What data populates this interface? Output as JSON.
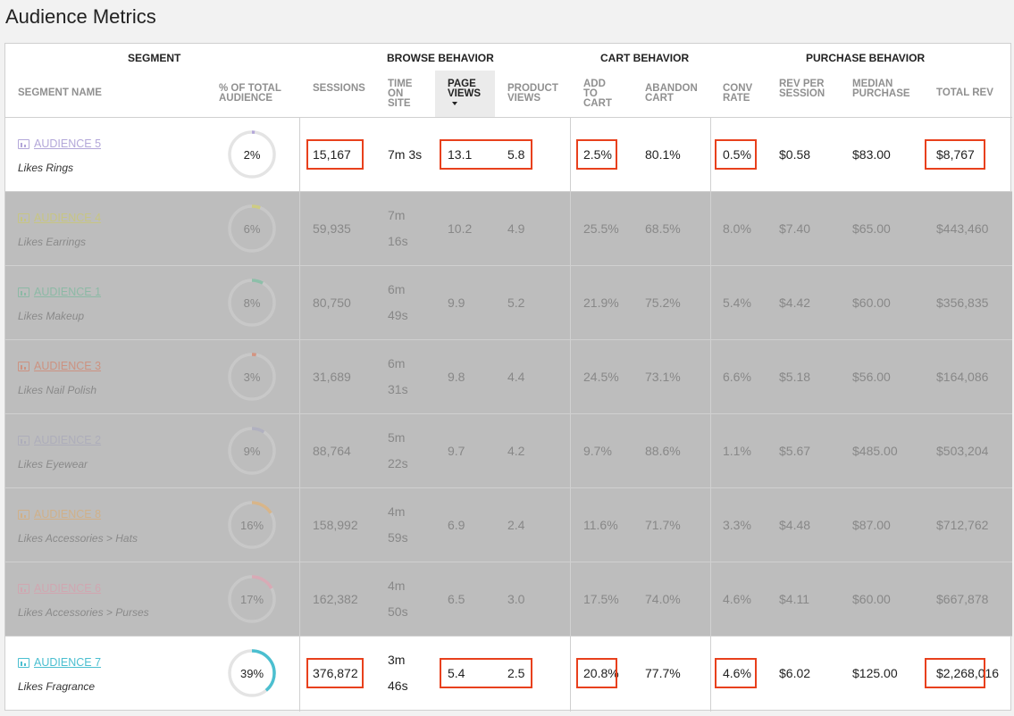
{
  "page_title": "Audience Metrics",
  "groups": {
    "segment": "SEGMENT",
    "browse": "BROWSE BEHAVIOR",
    "cart": "CART BEHAVIOR",
    "purchase": "PURCHASE BEHAVIOR"
  },
  "columns": {
    "segment_name": "SEGMENT NAME",
    "pct_total": "% OF TOTAL\nAUDIENCE",
    "sessions": "SESSIONS",
    "time_on_site": "TIME\nON\nSITE",
    "page_views": "PAGE\nVIEWS",
    "product_views": "PRODUCT\nVIEWS",
    "add_to_cart": "ADD\nTO\nCART",
    "abandon_cart": "ABANDON\nCART",
    "conv_rate": "CONV\nRATE",
    "rev_per_session": "REV PER\nSESSION",
    "median_purchase": "MEDIAN\nPURCHASE",
    "total_rev": "TOTAL REV"
  },
  "rows": [
    {
      "name": "AUDIENCE 5",
      "desc": "Likes Rings",
      "color": "#b3a7d9",
      "pct_label": "2%",
      "pct": 0.02,
      "sessions": "15,167",
      "time": "7m 3s",
      "page_views": "13.1",
      "product_views": "5.8",
      "add_to_cart": "2.5%",
      "abandon_cart": "80.1%",
      "conv_rate": "0.5%",
      "rev_per_session": "$0.58",
      "median_purchase": "$83.00",
      "total_rev": "$8,767",
      "dimmed": false
    },
    {
      "name": "AUDIENCE 4",
      "desc": "Likes Earrings",
      "color": "#d4cf3e",
      "pct_label": "6%",
      "pct": 0.06,
      "sessions": "59,935",
      "time": "7m\n16s",
      "page_views": "10.2",
      "product_views": "4.9",
      "add_to_cart": "25.5%",
      "abandon_cart": "68.5%",
      "conv_rate": "8.0%",
      "rev_per_session": "$7.40",
      "median_purchase": "$65.00",
      "total_rev": "$443,460",
      "dimmed": true
    },
    {
      "name": "AUDIENCE 1",
      "desc": "Likes Makeup",
      "color": "#52b68a",
      "pct_label": "8%",
      "pct": 0.08,
      "sessions": "80,750",
      "time": "6m\n49s",
      "page_views": "9.9",
      "product_views": "5.2",
      "add_to_cart": "21.9%",
      "abandon_cart": "75.2%",
      "conv_rate": "5.4%",
      "rev_per_session": "$4.42",
      "median_purchase": "$60.00",
      "total_rev": "$356,835",
      "dimmed": true
    },
    {
      "name": "AUDIENCE 3",
      "desc": "Likes Nail Polish",
      "color": "#e0603a",
      "pct_label": "3%",
      "pct": 0.03,
      "sessions": "31,689",
      "time": "6m\n31s",
      "page_views": "9.8",
      "product_views": "4.4",
      "add_to_cart": "24.5%",
      "abandon_cart": "73.1%",
      "conv_rate": "6.6%",
      "rev_per_session": "$5.18",
      "median_purchase": "$56.00",
      "total_rev": "$164,086",
      "dimmed": true
    },
    {
      "name": "AUDIENCE 2",
      "desc": "Likes Eyewear",
      "color": "#9a9ab8",
      "pct_label": "9%",
      "pct": 0.09,
      "sessions": "88,764",
      "time": "5m\n22s",
      "page_views": "9.7",
      "product_views": "4.2",
      "add_to_cart": "9.7%",
      "abandon_cart": "88.6%",
      "conv_rate": "1.1%",
      "rev_per_session": "$5.67",
      "median_purchase": "$485.00",
      "total_rev": "$503,204",
      "dimmed": true
    },
    {
      "name": "AUDIENCE 8",
      "desc": "Likes Accessories > Hats",
      "color": "#e8a24a",
      "pct_label": "16%",
      "pct": 0.16,
      "sessions": "158,992",
      "time": "4m\n59s",
      "page_views": "6.9",
      "product_views": "2.4",
      "add_to_cart": "11.6%",
      "abandon_cart": "71.7%",
      "conv_rate": "3.3%",
      "rev_per_session": "$4.48",
      "median_purchase": "$87.00",
      "total_rev": "$712,762",
      "dimmed": true
    },
    {
      "name": "AUDIENCE 6",
      "desc": "Likes Accessories > Purses",
      "color": "#e88ba2",
      "pct_label": "17%",
      "pct": 0.17,
      "sessions": "162,382",
      "time": "4m\n50s",
      "page_views": "6.5",
      "product_views": "3.0",
      "add_to_cart": "17.5%",
      "abandon_cart": "74.0%",
      "conv_rate": "4.6%",
      "rev_per_session": "$4.11",
      "median_purchase": "$60.00",
      "total_rev": "$667,878",
      "dimmed": true
    },
    {
      "name": "AUDIENCE 7",
      "desc": "Likes Fragrance",
      "color": "#4bbfd0",
      "pct_label": "39%",
      "pct": 0.39,
      "sessions": "376,872",
      "time": "3m\n46s",
      "page_views": "5.4",
      "product_views": "2.5",
      "add_to_cart": "20.8%",
      "abandon_cart": "77.7%",
      "conv_rate": "4.6%",
      "rev_per_session": "$6.02",
      "median_purchase": "$125.00",
      "total_rev": "$2,268,016",
      "dimmed": false
    }
  ]
}
